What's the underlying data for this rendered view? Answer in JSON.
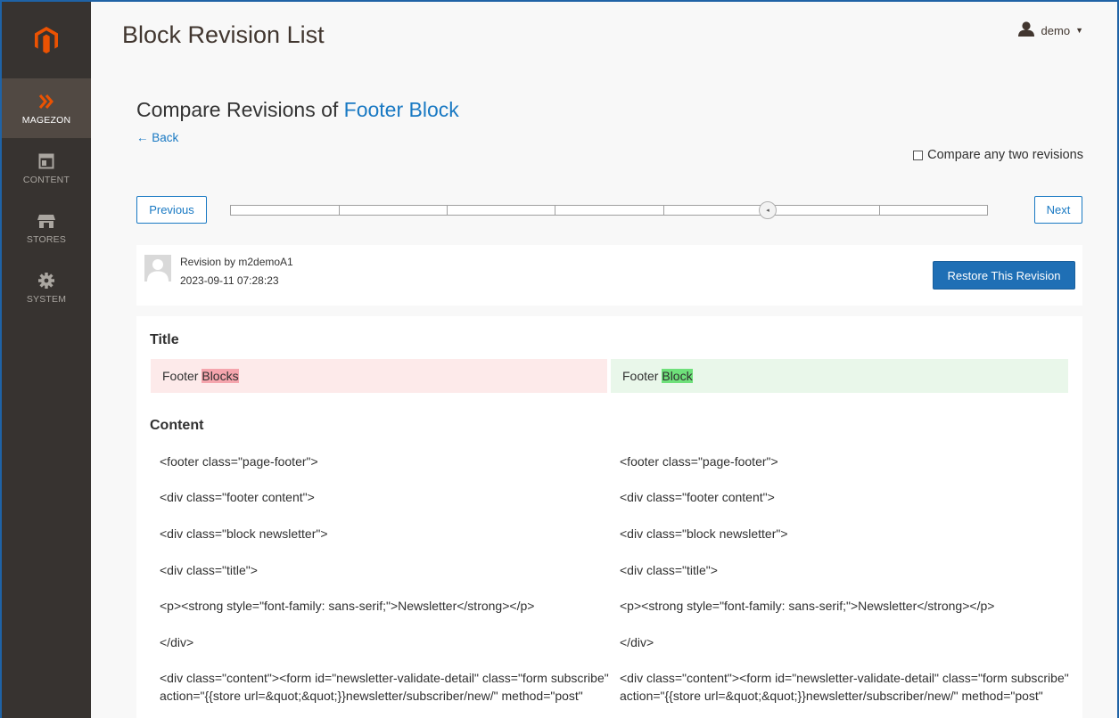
{
  "sidebar": {
    "items": [
      {
        "label": "MAGEZON",
        "icon": "magezon-chevron-icon"
      },
      {
        "label": "CONTENT",
        "icon": "content-layout-icon"
      },
      {
        "label": "STORES",
        "icon": "stores-icon"
      },
      {
        "label": "SYSTEM",
        "icon": "gear-icon"
      }
    ]
  },
  "header": {
    "title": "Block Revision List",
    "user": "demo"
  },
  "compare": {
    "heading_prefix": "Compare Revisions of ",
    "block_name": "Footer Block",
    "back_label": "← Back",
    "compare_any_label": "Compare any two revisions",
    "compare_any_checked": false
  },
  "slider": {
    "previous_label": "Previous",
    "next_label": "Next",
    "tick_count": 7,
    "current_position": 0.71
  },
  "revision": {
    "author_label": "Revision by m2demoA1",
    "date": "2023-09-11 07:28:23",
    "restore_label": "Restore This Revision"
  },
  "diff": {
    "title_heading": "Title",
    "title_old_prefix": "Footer",
    "title_old_changed": "Blocks",
    "title_new_prefix": "Footer",
    "title_new_changed": "Block",
    "content_heading": "Content",
    "left_lines": [
      "<footer class=\"page-footer\">",
      "<div class=\"footer content\">",
      "<div class=\"block newsletter\">",
      "<div class=\"title\">",
      "<p><strong style=\"font-family: sans-serif;\">Newsletter</strong></p>",
      "</div>",
      "<div class=\"content\"><form id=\"newsletter-validate-detail\" class=\"form subscribe\" action=\"{{store url=&quot;&quot;}}newsletter/subscriber/new/\" method=\"post\""
    ],
    "right_lines": [
      "<footer class=\"page-footer\">",
      "<div class=\"footer content\">",
      "<div class=\"block newsletter\">",
      "<div class=\"title\">",
      "<p><strong style=\"font-family: sans-serif;\">Newsletter</strong></p>",
      "</div>",
      "<div class=\"content\"><form id=\"newsletter-validate-detail\" class=\"form subscribe\" action=\"{{store url=&quot;&quot;}}newsletter/subscriber/new/\" method=\"post\""
    ]
  },
  "colors": {
    "sidebar_bg": "#373330",
    "sidebar_active": "#514943",
    "logo_orange": "#eb5202",
    "link_blue": "#1979c3",
    "primary_button": "#1f6fb5",
    "diff_del_bg": "#fdeaea",
    "diff_del_hl": "#f5a5ad",
    "diff_add_bg": "#e9f7ea",
    "diff_add_hl": "#6ee07a"
  }
}
